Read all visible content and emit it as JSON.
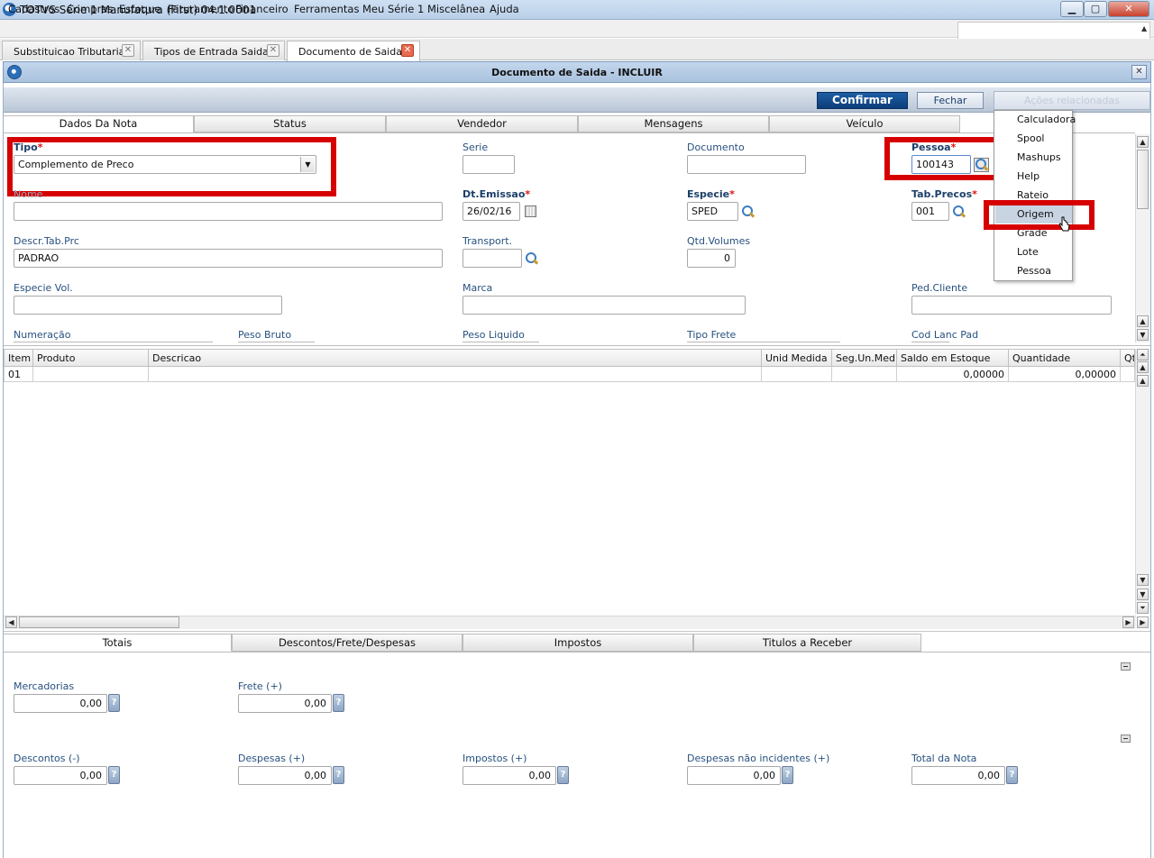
{
  "window": {
    "title": "TOTVS Série 1 Manufatura (First) 04.1.0001",
    "min": "▁",
    "max": "▢",
    "close": "✕"
  },
  "menubar": [
    "Cadastros",
    "Compras",
    "Estoque",
    "Faturamento",
    "Financeiro",
    "Ferramentas",
    "Meu Série 1",
    "Miscelânea",
    "Ajuda"
  ],
  "toptabs": [
    "Substituicao Tributaria",
    "Tipos de Entrada Saida",
    "Documento de Saida"
  ],
  "dialog": {
    "title": "Documento de Saida - INCLUIR",
    "close": "✕"
  },
  "toolbar": {
    "confirm": "Confirmar",
    "close": "Fechar",
    "actions": "Ações relacionadas"
  },
  "form_tabs": [
    "Dados Da Nota",
    "Status",
    "Vendedor",
    "Mensagens",
    "Veículo"
  ],
  "fields": {
    "tipo_label": "Tipo",
    "tipo_value": "Complemento de Preco",
    "serie_label": "Serie",
    "serie_value": "",
    "documento_label": "Documento",
    "documento_value": "",
    "pessoa_label": "Pessoa",
    "pessoa_value": "100143",
    "nome_label": "Nome",
    "nome_value": "",
    "dtemissao_label": "Dt.Emissao",
    "dtemissao_value": "26/02/16",
    "especie_label": "Especie",
    "especie_value": "SPED",
    "tabprecos_label": "Tab.Precos",
    "tabprecos_value": "001",
    "descrtab_label": "Descr.Tab.Prc",
    "descrtab_value": "PADRAO",
    "transport_label": "Transport.",
    "transport_value": "",
    "qtdvol_label": "Qtd.Volumes",
    "qtdvol_value": "0",
    "especievol_label": "Especie Vol.",
    "especievol_value": "",
    "marca_label": "Marca",
    "marca_value": "",
    "pedcliente_label": "Ped.Cliente",
    "pedcliente_value": "",
    "numeracao_label": "Numeração",
    "pesobruto_label": "Peso Bruto",
    "pesoliquido_label": "Peso Liquido",
    "tipofrete_label": "Tipo Frete",
    "codlanc_label": "Cod Lanc Pad",
    "required_mark": "*"
  },
  "grid": {
    "headers": [
      "Item",
      "Produto",
      "Descricao",
      "Unid Medida",
      "Seg.Un.Med",
      "Saldo em Estoque",
      "Quantidade",
      "Qt"
    ],
    "rows": [
      [
        "01",
        "",
        "",
        "",
        "",
        "0,00000",
        "0,00000",
        ""
      ]
    ]
  },
  "actions_menu": [
    "Calculadora",
    "Spool",
    "Mashups",
    "Help",
    "Rateio",
    "Origem",
    "Grade",
    "Lote",
    "Pessoa"
  ],
  "bottom_tabs": [
    "Totais",
    "Descontos/Frete/Despesas",
    "Impostos",
    "Titulos a Receber"
  ],
  "totals": {
    "mercadorias_label": "Mercadorias",
    "mercadorias_value": "0,00",
    "frete_label": "Frete (+)",
    "frete_value": "0,00",
    "descontos_label": "Descontos (-)",
    "descontos_value": "0,00",
    "despesas_label": "Despesas (+)",
    "despesas_value": "0,00",
    "impostos_label": "Impostos (+)",
    "impostos_value": "0,00",
    "despnaoinc_label": "Despesas não incidentes (+)",
    "despnaoinc_value": "0,00",
    "totalnota_label": "Total da Nota",
    "totalnota_value": "0,00",
    "help": "?"
  },
  "scroll": {
    "up": "▲",
    "down": "▼",
    "left": "◀",
    "right": "▶",
    "top": "⏶",
    "bottom": "⏷"
  },
  "colors": {
    "highlight_red": "#d60000",
    "confirm_blue": "#0c3d78",
    "label_blue": "#27517f"
  }
}
